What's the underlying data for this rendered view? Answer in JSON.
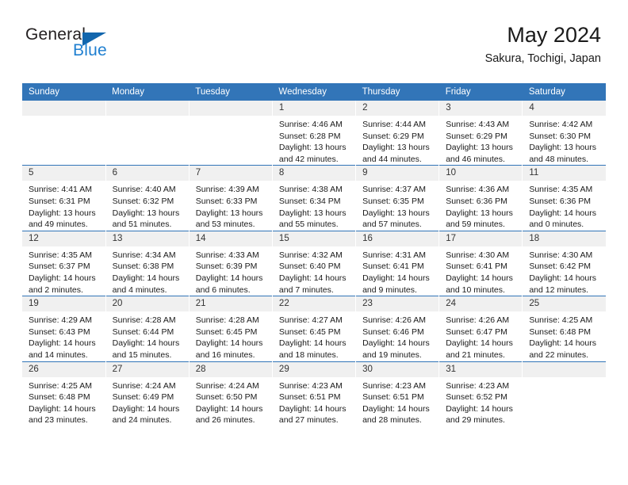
{
  "brand": {
    "name_top": "General",
    "name_bottom": "Blue",
    "accent_color": "#1f7fd0",
    "triangle_color": "#1266ad"
  },
  "header": {
    "title": "May 2024",
    "subtitle": "Sakura, Tochigi, Japan"
  },
  "theme": {
    "header_row_bg": "#3275b8",
    "daynum_bg": "#f0f0f0",
    "text_color": "#1a1a1a"
  },
  "weekday_headers": [
    "Sunday",
    "Monday",
    "Tuesday",
    "Wednesday",
    "Thursday",
    "Friday",
    "Saturday"
  ],
  "labels": {
    "sunrise": "Sunrise:",
    "sunset": "Sunset:",
    "daylight": "Daylight:"
  },
  "weeks": [
    [
      {
        "day": "",
        "detail": ""
      },
      {
        "day": "",
        "detail": ""
      },
      {
        "day": "",
        "detail": ""
      },
      {
        "day": "1",
        "detail": "Sunrise: 4:46 AM\nSunset: 6:28 PM\nDaylight: 13 hours and 42 minutes."
      },
      {
        "day": "2",
        "detail": "Sunrise: 4:44 AM\nSunset: 6:29 PM\nDaylight: 13 hours and 44 minutes."
      },
      {
        "day": "3",
        "detail": "Sunrise: 4:43 AM\nSunset: 6:29 PM\nDaylight: 13 hours and 46 minutes."
      },
      {
        "day": "4",
        "detail": "Sunrise: 4:42 AM\nSunset: 6:30 PM\nDaylight: 13 hours and 48 minutes."
      }
    ],
    [
      {
        "day": "5",
        "detail": "Sunrise: 4:41 AM\nSunset: 6:31 PM\nDaylight: 13 hours and 49 minutes."
      },
      {
        "day": "6",
        "detail": "Sunrise: 4:40 AM\nSunset: 6:32 PM\nDaylight: 13 hours and 51 minutes."
      },
      {
        "day": "7",
        "detail": "Sunrise: 4:39 AM\nSunset: 6:33 PM\nDaylight: 13 hours and 53 minutes."
      },
      {
        "day": "8",
        "detail": "Sunrise: 4:38 AM\nSunset: 6:34 PM\nDaylight: 13 hours and 55 minutes."
      },
      {
        "day": "9",
        "detail": "Sunrise: 4:37 AM\nSunset: 6:35 PM\nDaylight: 13 hours and 57 minutes."
      },
      {
        "day": "10",
        "detail": "Sunrise: 4:36 AM\nSunset: 6:36 PM\nDaylight: 13 hours and 59 minutes."
      },
      {
        "day": "11",
        "detail": "Sunrise: 4:35 AM\nSunset: 6:36 PM\nDaylight: 14 hours and 0 minutes."
      }
    ],
    [
      {
        "day": "12",
        "detail": "Sunrise: 4:35 AM\nSunset: 6:37 PM\nDaylight: 14 hours and 2 minutes."
      },
      {
        "day": "13",
        "detail": "Sunrise: 4:34 AM\nSunset: 6:38 PM\nDaylight: 14 hours and 4 minutes."
      },
      {
        "day": "14",
        "detail": "Sunrise: 4:33 AM\nSunset: 6:39 PM\nDaylight: 14 hours and 6 minutes."
      },
      {
        "day": "15",
        "detail": "Sunrise: 4:32 AM\nSunset: 6:40 PM\nDaylight: 14 hours and 7 minutes."
      },
      {
        "day": "16",
        "detail": "Sunrise: 4:31 AM\nSunset: 6:41 PM\nDaylight: 14 hours and 9 minutes."
      },
      {
        "day": "17",
        "detail": "Sunrise: 4:30 AM\nSunset: 6:41 PM\nDaylight: 14 hours and 10 minutes."
      },
      {
        "day": "18",
        "detail": "Sunrise: 4:30 AM\nSunset: 6:42 PM\nDaylight: 14 hours and 12 minutes."
      }
    ],
    [
      {
        "day": "19",
        "detail": "Sunrise: 4:29 AM\nSunset: 6:43 PM\nDaylight: 14 hours and 14 minutes."
      },
      {
        "day": "20",
        "detail": "Sunrise: 4:28 AM\nSunset: 6:44 PM\nDaylight: 14 hours and 15 minutes."
      },
      {
        "day": "21",
        "detail": "Sunrise: 4:28 AM\nSunset: 6:45 PM\nDaylight: 14 hours and 16 minutes."
      },
      {
        "day": "22",
        "detail": "Sunrise: 4:27 AM\nSunset: 6:45 PM\nDaylight: 14 hours and 18 minutes."
      },
      {
        "day": "23",
        "detail": "Sunrise: 4:26 AM\nSunset: 6:46 PM\nDaylight: 14 hours and 19 minutes."
      },
      {
        "day": "24",
        "detail": "Sunrise: 4:26 AM\nSunset: 6:47 PM\nDaylight: 14 hours and 21 minutes."
      },
      {
        "day": "25",
        "detail": "Sunrise: 4:25 AM\nSunset: 6:48 PM\nDaylight: 14 hours and 22 minutes."
      }
    ],
    [
      {
        "day": "26",
        "detail": "Sunrise: 4:25 AM\nSunset: 6:48 PM\nDaylight: 14 hours and 23 minutes."
      },
      {
        "day": "27",
        "detail": "Sunrise: 4:24 AM\nSunset: 6:49 PM\nDaylight: 14 hours and 24 minutes."
      },
      {
        "day": "28",
        "detail": "Sunrise: 4:24 AM\nSunset: 6:50 PM\nDaylight: 14 hours and 26 minutes."
      },
      {
        "day": "29",
        "detail": "Sunrise: 4:23 AM\nSunset: 6:51 PM\nDaylight: 14 hours and 27 minutes."
      },
      {
        "day": "30",
        "detail": "Sunrise: 4:23 AM\nSunset: 6:51 PM\nDaylight: 14 hours and 28 minutes."
      },
      {
        "day": "31",
        "detail": "Sunrise: 4:23 AM\nSunset: 6:52 PM\nDaylight: 14 hours and 29 minutes."
      },
      {
        "day": "",
        "detail": ""
      }
    ]
  ]
}
